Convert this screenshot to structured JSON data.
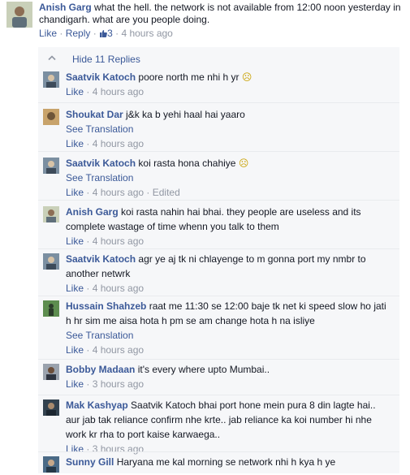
{
  "top_comment": {
    "author": "Anish Garg",
    "text": "what the hell. the network is not available from 12:00 noon yesterday in chandigarh. what are you people doing.",
    "like": "Like",
    "reply": "Reply",
    "likes": "3",
    "time": "4 hours ago",
    "separator": "·"
  },
  "replies_toggle": {
    "label": "Hide 11 Replies"
  },
  "replies": [
    {
      "author": "Saatvik Katoch",
      "text": "poore north me nhi h yr",
      "emoticon": "☹",
      "translation": "",
      "like": "Like",
      "time": "4 hours ago",
      "edited": ""
    },
    {
      "author": "Shoukat Dar",
      "text": "j&k ka b yehi haal hai yaaro",
      "emoticon": "",
      "translation": "See Translation",
      "like": "Like",
      "time": "4 hours ago",
      "edited": ""
    },
    {
      "author": "Saatvik Katoch",
      "text": "koi rasta hona chahiye",
      "emoticon": "☹",
      "translation": "See Translation",
      "like": "Like",
      "time": "4 hours ago",
      "edited": "Edited"
    },
    {
      "author": "Anish Garg",
      "text": "koi rasta nahin hai bhai. they people are useless and its complete wastage of time whenn you talk to them",
      "emoticon": "",
      "translation": "",
      "like": "Like",
      "time": "4 hours ago",
      "edited": ""
    },
    {
      "author": "Saatvik Katoch",
      "text": "agr ye aj tk ni chlayenge to m gonna port my nmbr to another netwrk",
      "emoticon": "",
      "translation": "",
      "like": "Like",
      "time": "4 hours ago",
      "edited": ""
    },
    {
      "author": "Hussain Shahzeb",
      "text": "raat me 11:30 se 12:00 baje tk net ki speed slow ho jati h hr sim me aisa hota h pm se am change hota h na isliye",
      "emoticon": "",
      "translation": "See Translation",
      "like": "Like",
      "time": "4 hours ago",
      "edited": ""
    },
    {
      "author": "Bobby Madaan",
      "text": "it's every where upto Mumbai..",
      "emoticon": "",
      "translation": "",
      "like": "Like",
      "time": "3 hours ago",
      "edited": ""
    },
    {
      "author": "Mak Kashyap",
      "text": "Saatvik Katoch bhai port hone mein pura 8 din lagte hai.. aur jab tak reliance confirm nhe krte.. jab reliance ka koi number hi nhe work kr rha to port kaise karwaega..",
      "emoticon": "",
      "translation": "",
      "like": "Like",
      "time": "3 hours ago",
      "edited": ""
    },
    {
      "author": "Sunny Gill",
      "text": "Haryana me kal morning se network nhi h kya h ye",
      "emoticon": "",
      "translation": "",
      "like": "",
      "time": "",
      "edited": ""
    }
  ],
  "colors": {
    "link": "#3b5998",
    "meta": "#9197a3",
    "panel": "#f6f7f9",
    "text": "#141823"
  },
  "icons": {
    "thumb": "thumbs-up-icon",
    "chevron": "chevron-up-icon",
    "emoticon": "frown-emoticon-icon"
  }
}
